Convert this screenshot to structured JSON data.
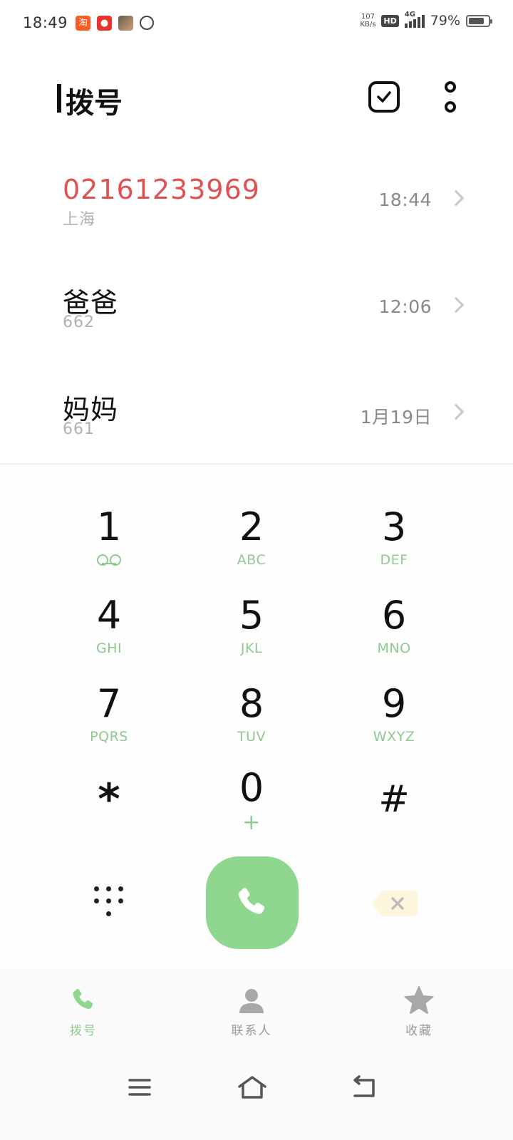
{
  "status_bar": {
    "time": "18:49",
    "net_speed_value": "107",
    "net_speed_unit": "KB/s",
    "hd": "HD",
    "network": "4G",
    "battery": "79%",
    "battery_level": 0.79
  },
  "header": {
    "title": "拨号"
  },
  "recent_calls": [
    {
      "name": "02161233969",
      "sub": "上海",
      "time": "18:44",
      "missed": true
    },
    {
      "name": "爸爸",
      "sub": "662",
      "time": "12:06",
      "missed": false
    },
    {
      "name": "妈妈",
      "sub": "661",
      "time": "1月19日",
      "missed": false
    }
  ],
  "dialpad": {
    "keys": [
      {
        "digit": "1",
        "letters": ""
      },
      {
        "digit": "2",
        "letters": "ABC"
      },
      {
        "digit": "3",
        "letters": "DEF"
      },
      {
        "digit": "4",
        "letters": "GHI"
      },
      {
        "digit": "5",
        "letters": "JKL"
      },
      {
        "digit": "6",
        "letters": "MNO"
      },
      {
        "digit": "7",
        "letters": "PQRS"
      },
      {
        "digit": "8",
        "letters": "TUV"
      },
      {
        "digit": "9",
        "letters": "WXYZ"
      },
      {
        "digit": "*",
        "letters": ""
      },
      {
        "digit": "0",
        "letters": "+"
      },
      {
        "digit": "#",
        "letters": ""
      }
    ]
  },
  "bottom_nav": {
    "tabs": [
      {
        "label": "拨号",
        "icon": "phone-icon",
        "active": true
      },
      {
        "label": "联系人",
        "icon": "person-icon",
        "active": false
      },
      {
        "label": "收藏",
        "icon": "star-icon",
        "active": false
      }
    ]
  },
  "colors": {
    "accent": "#8fd68f",
    "missed": "#e05252",
    "letters": "#8fc98f"
  }
}
